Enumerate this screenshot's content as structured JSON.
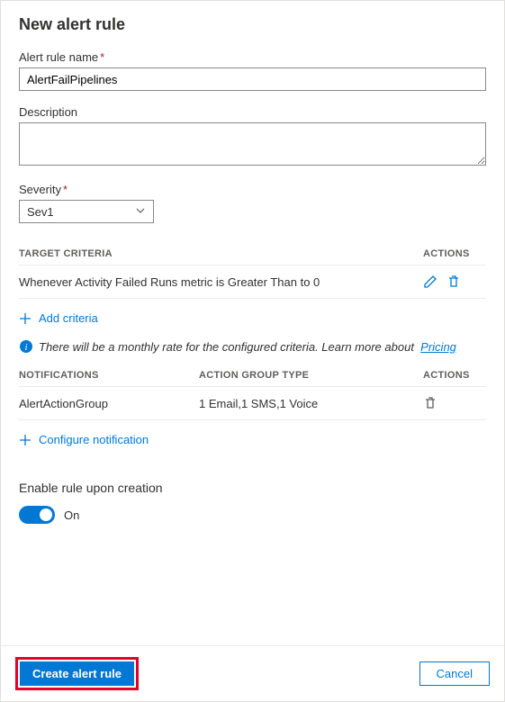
{
  "title": "New alert rule",
  "fields": {
    "name_label": "Alert rule name",
    "name_value": "AlertFailPipelines",
    "description_label": "Description",
    "description_value": "",
    "severity_label": "Severity",
    "severity_value": "Sev1"
  },
  "targetCriteria": {
    "header": "TARGET CRITERIA",
    "actions_header": "ACTIONS",
    "items": [
      {
        "text": "Whenever Activity Failed Runs metric is Greater Than to 0"
      }
    ],
    "add_label": "Add criteria"
  },
  "infoNote": {
    "text": "There will be a monthly rate for the configured criteria. Learn more about",
    "link_label": "Pricing"
  },
  "notifications": {
    "header": "NOTIFICATIONS",
    "agtype_header": "ACTION GROUP TYPE",
    "actions_header": "ACTIONS",
    "items": [
      {
        "name": "AlertActionGroup",
        "type": "1 Email,1 SMS,1 Voice"
      }
    ],
    "configure_label": "Configure notification"
  },
  "enable": {
    "label": "Enable rule upon creation",
    "state_label": "On"
  },
  "footer": {
    "create_label": "Create alert rule",
    "cancel_label": "Cancel"
  }
}
